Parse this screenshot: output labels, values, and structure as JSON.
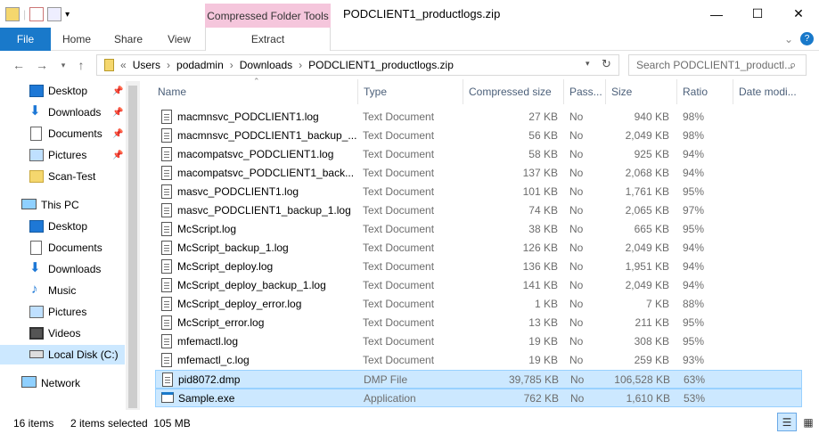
{
  "window": {
    "title": "PODCLIENT1_productlogs.zip",
    "minimize_glyph": "—",
    "maximize_glyph": "☐",
    "close_glyph": "✕"
  },
  "ribbon": {
    "context_tab": "Compressed Folder Tools",
    "tabs": [
      "File",
      "Home",
      "Share",
      "View",
      "Extract"
    ],
    "expand_glyph": "⌄",
    "help_glyph": "?"
  },
  "address": {
    "breadcrumb": [
      "«",
      "Users",
      "podadmin",
      "Downloads",
      "PODCLIENT1_productlogs.zip"
    ],
    "search_placeholder": "Search PODCLIENT1_productl...",
    "sep": "›"
  },
  "nav": {
    "quick_access": [
      {
        "label": "Desktop",
        "icon": "desktop-icon",
        "pinned": true
      },
      {
        "label": "Downloads",
        "icon": "downloads-icon",
        "pinned": true
      },
      {
        "label": "Documents",
        "icon": "documents-icon",
        "pinned": true
      },
      {
        "label": "Pictures",
        "icon": "pictures-icon",
        "pinned": true
      },
      {
        "label": "Scan-Test",
        "icon": "folder-icon",
        "pinned": false
      }
    ],
    "this_pc": "This PC",
    "pc_items": [
      {
        "label": "Desktop",
        "icon": "desktop-icon"
      },
      {
        "label": "Documents",
        "icon": "documents-icon"
      },
      {
        "label": "Downloads",
        "icon": "downloads-icon"
      },
      {
        "label": "Music",
        "icon": "music-icon"
      },
      {
        "label": "Pictures",
        "icon": "pictures-icon"
      },
      {
        "label": "Videos",
        "icon": "videos-icon"
      },
      {
        "label": "Local Disk (C:)",
        "icon": "disk-icon"
      }
    ],
    "network": "Network"
  },
  "columns": [
    "Name",
    "Type",
    "Compressed size",
    "Pass...",
    "Size",
    "Ratio",
    "Date modi..."
  ],
  "files": [
    {
      "name": "macmnsvc_PODCLIENT1.log",
      "type": "Text Document",
      "compressed": "27 KB",
      "password": "No",
      "size": "940 KB",
      "ratio": "98%",
      "selected": false
    },
    {
      "name": "macmnsvc_PODCLIENT1_backup_...",
      "type": "Text Document",
      "compressed": "56 KB",
      "password": "No",
      "size": "2,049 KB",
      "ratio": "98%",
      "selected": false
    },
    {
      "name": "macompatsvc_PODCLIENT1.log",
      "type": "Text Document",
      "compressed": "58 KB",
      "password": "No",
      "size": "925 KB",
      "ratio": "94%",
      "selected": false
    },
    {
      "name": "macompatsvc_PODCLIENT1_back...",
      "type": "Text Document",
      "compressed": "137 KB",
      "password": "No",
      "size": "2,068 KB",
      "ratio": "94%",
      "selected": false
    },
    {
      "name": "masvc_PODCLIENT1.log",
      "type": "Text Document",
      "compressed": "101 KB",
      "password": "No",
      "size": "1,761 KB",
      "ratio": "95%",
      "selected": false
    },
    {
      "name": "masvc_PODCLIENT1_backup_1.log",
      "type": "Text Document",
      "compressed": "74 KB",
      "password": "No",
      "size": "2,065 KB",
      "ratio": "97%",
      "selected": false
    },
    {
      "name": "McScript.log",
      "type": "Text Document",
      "compressed": "38 KB",
      "password": "No",
      "size": "665 KB",
      "ratio": "95%",
      "selected": false
    },
    {
      "name": "McScript_backup_1.log",
      "type": "Text Document",
      "compressed": "126 KB",
      "password": "No",
      "size": "2,049 KB",
      "ratio": "94%",
      "selected": false
    },
    {
      "name": "McScript_deploy.log",
      "type": "Text Document",
      "compressed": "136 KB",
      "password": "No",
      "size": "1,951 KB",
      "ratio": "94%",
      "selected": false
    },
    {
      "name": "McScript_deploy_backup_1.log",
      "type": "Text Document",
      "compressed": "141 KB",
      "password": "No",
      "size": "2,049 KB",
      "ratio": "94%",
      "selected": false
    },
    {
      "name": "McScript_deploy_error.log",
      "type": "Text Document",
      "compressed": "1 KB",
      "password": "No",
      "size": "7 KB",
      "ratio": "88%",
      "selected": false
    },
    {
      "name": "McScript_error.log",
      "type": "Text Document",
      "compressed": "13 KB",
      "password": "No",
      "size": "211 KB",
      "ratio": "95%",
      "selected": false
    },
    {
      "name": "mfemactl.log",
      "type": "Text Document",
      "compressed": "19 KB",
      "password": "No",
      "size": "308 KB",
      "ratio": "95%",
      "selected": false
    },
    {
      "name": "mfemactl_c.log",
      "type": "Text Document",
      "compressed": "19 KB",
      "password": "No",
      "size": "259 KB",
      "ratio": "93%",
      "selected": false
    },
    {
      "name": "pid8072.dmp",
      "type": "DMP File",
      "compressed": "39,785 KB",
      "password": "No",
      "size": "106,528 KB",
      "ratio": "63%",
      "selected": true
    },
    {
      "name": "Sample.exe",
      "type": "Application",
      "compressed": "762 KB",
      "password": "No",
      "size": "1,610 KB",
      "ratio": "53%",
      "selected": true
    }
  ],
  "status": {
    "count": "16 items",
    "selection": "2 items selected  105 MB"
  },
  "colors": {
    "accent": "#1979ca",
    "selection": "#cce8ff",
    "context_tab": "#f5c6dc"
  }
}
